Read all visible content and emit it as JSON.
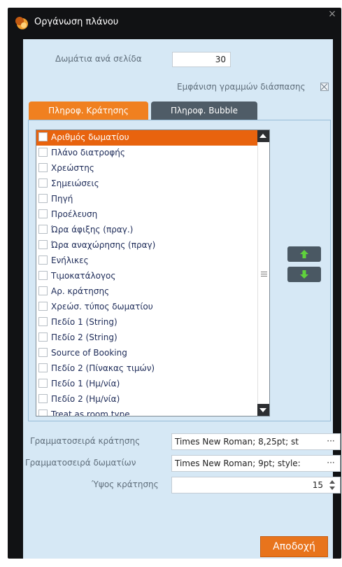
{
  "window": {
    "title": "Οργάνωση πλάνου",
    "close_glyph": "×",
    "icon": "app-logo-icon"
  },
  "settings": {
    "rooms_per_page_label": "Δωμάτια ανά σελίδα",
    "rooms_per_page_value": "30",
    "show_split_lines_label": "Εμφάνιση γραμμών διάσπασης",
    "show_split_lines_checked": true
  },
  "tabs": [
    {
      "label": "Πληροφ. Κράτησης",
      "active": true
    },
    {
      "label": "Πληροφ. Bubble",
      "active": false
    }
  ],
  "fields_list": {
    "items": [
      {
        "label": "Αριθμός δωματίου",
        "checked": false,
        "selected": true
      },
      {
        "label": "Πλάνο διατροφής",
        "checked": false,
        "selected": false
      },
      {
        "label": "Χρεώστης",
        "checked": false,
        "selected": false
      },
      {
        "label": "Σημειώσεις",
        "checked": false,
        "selected": false
      },
      {
        "label": "Πηγή",
        "checked": false,
        "selected": false
      },
      {
        "label": "Προέλευση",
        "checked": false,
        "selected": false
      },
      {
        "label": "Ώρα άφιξης (πραγ.)",
        "checked": false,
        "selected": false
      },
      {
        "label": "Ώρα αναχώρησης (πραγ)",
        "checked": false,
        "selected": false
      },
      {
        "label": "Ενήλικες",
        "checked": false,
        "selected": false
      },
      {
        "label": "Τιμοκατάλογος",
        "checked": false,
        "selected": false
      },
      {
        "label": "Αρ. κράτησης",
        "checked": false,
        "selected": false
      },
      {
        "label": "Χρεώσ. τύπος δωματίου",
        "checked": false,
        "selected": false
      },
      {
        "label": "Πεδίο 1 (String)",
        "checked": false,
        "selected": false
      },
      {
        "label": "Πεδίο 2 (String)",
        "checked": false,
        "selected": false
      },
      {
        "label": "Source of Booking",
        "checked": false,
        "selected": false
      },
      {
        "label": "Πεδίο 2 (Πίνακας τιμών)",
        "checked": false,
        "selected": false
      },
      {
        "label": "Πεδίο 1 (Ημ/νία)",
        "checked": false,
        "selected": false
      },
      {
        "label": "Πεδίο 2 (Ημ/νία)",
        "checked": false,
        "selected": false
      },
      {
        "label": "Treat as room type",
        "checked": false,
        "selected": false
      }
    ],
    "move_up_icon": "arrow-up-icon",
    "move_down_icon": "arrow-down-icon"
  },
  "fonts": {
    "booking_font_label": "Γραμματοσειρά κράτησης",
    "booking_font_value": "Times New Roman; 8,25pt; st",
    "rooms_font_label": "Γραμματοσειρά δωματίων",
    "rooms_font_value": "Times New Roman; 9pt; style:",
    "ellipsis": "···"
  },
  "booking_height": {
    "label": "Ύψος κράτησης",
    "value": "15"
  },
  "accept_label": "Αποδοχή",
  "colors": {
    "accent_orange": "#f08020",
    "background": "#d6e8f5",
    "selection": "#e8630e",
    "frame": "#111214"
  }
}
